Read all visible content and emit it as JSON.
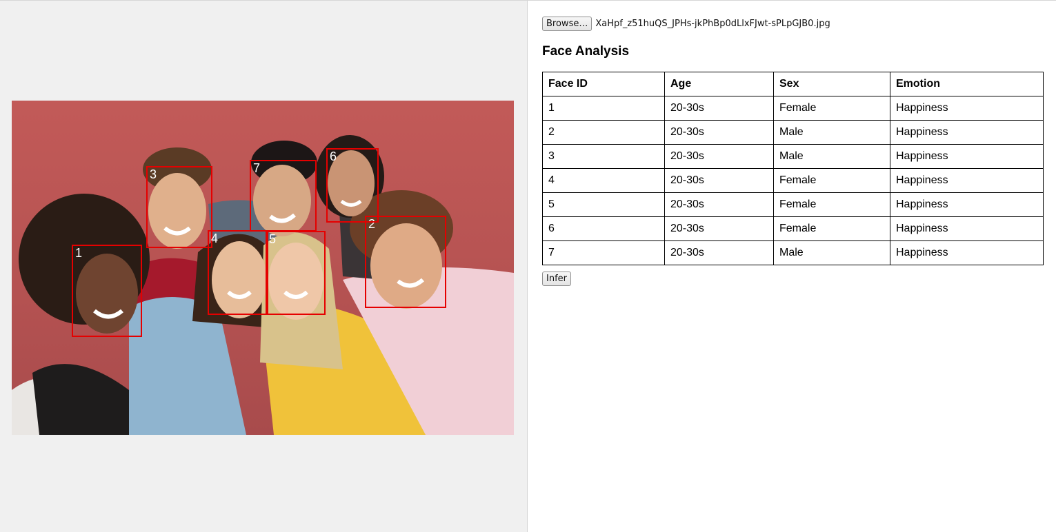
{
  "file_input": {
    "browse_label": "Browse…",
    "file_name": "XaHpf_z51huQS_JPHs-jkPhBp0dLlxFJwt-sPLpGJB0.jpg"
  },
  "title": "Face Analysis",
  "table": {
    "headers": [
      "Face ID",
      "Age",
      "Sex",
      "Emotion"
    ],
    "rows": [
      [
        "1",
        "20-30s",
        "Female",
        "Happiness"
      ],
      [
        "2",
        "20-30s",
        "Male",
        "Happiness"
      ],
      [
        "3",
        "20-30s",
        "Male",
        "Happiness"
      ],
      [
        "4",
        "20-30s",
        "Female",
        "Happiness"
      ],
      [
        "5",
        "20-30s",
        "Female",
        "Happiness"
      ],
      [
        "6",
        "20-30s",
        "Female",
        "Happiness"
      ],
      [
        "7",
        "20-30s",
        "Male",
        "Happiness"
      ]
    ]
  },
  "infer_label": "Infer",
  "face_labels": [
    "1",
    "2",
    "3",
    "4",
    "5",
    "6",
    "7"
  ],
  "colors": {
    "box": "#e50000",
    "left_pane_bg": "#f0f0f0",
    "photo_wall": "#b85453"
  }
}
